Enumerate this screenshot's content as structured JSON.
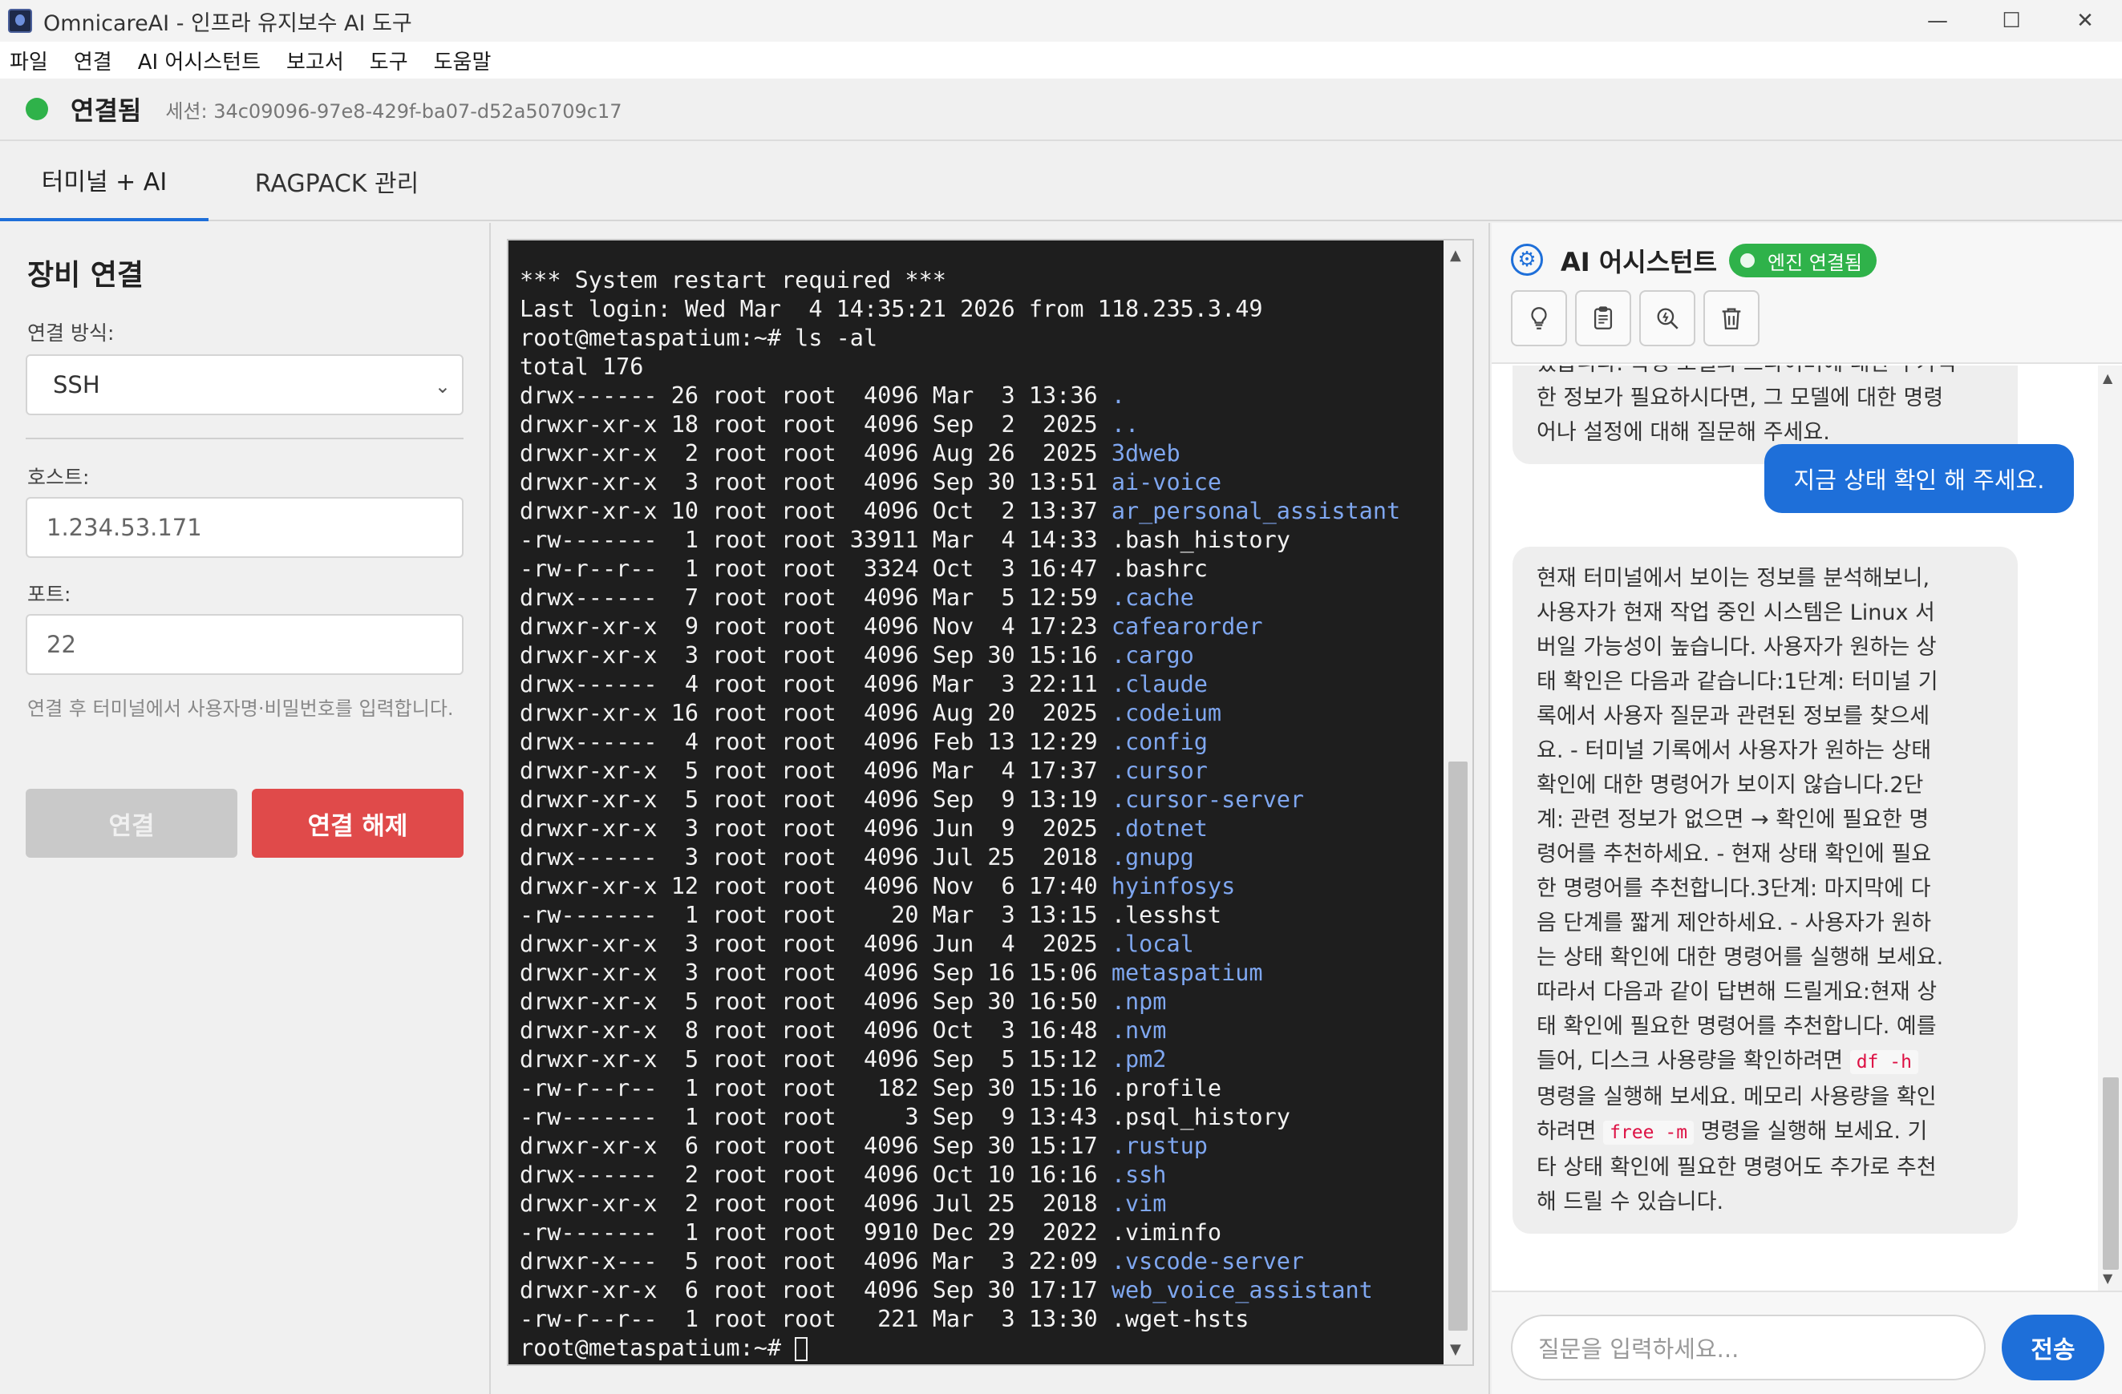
{
  "window": {
    "title": "OmnicareAI - 인프라 유지보수 AI 도구",
    "controls": {
      "minimize": "—",
      "maximize": "☐",
      "close": "✕"
    }
  },
  "menu": [
    "파일",
    "연결",
    "AI 어시스턴트",
    "보고서",
    "도구",
    "도움말"
  ],
  "status": {
    "state": "연결됨",
    "session": "세션: 34c09096-97e8-429f-ba07-d52a50709c17",
    "dot_color": "#2fb24a"
  },
  "tabs": [
    {
      "label": "터미널 + AI",
      "active": true
    },
    {
      "label": "RAGPACK 관리",
      "active": false
    }
  ],
  "device": {
    "title": "장비 연결",
    "method_label": "연결 방식:",
    "method_value": "SSH",
    "host_label": "호스트:",
    "host_value": "1.234.53.171",
    "port_label": "포트:",
    "port_value": "22",
    "hint": "연결 후 터미널에서 사용자명·비밀번호를 입력합니다.",
    "connect_button": "연결",
    "disconnect_button": "연결 해제"
  },
  "terminal": {
    "lines": [
      {
        "text": "*** System restart required ***",
        "name": ""
      },
      {
        "text": "Last login: Wed Mar  4 14:35:21 2026 from 118.235.3.49",
        "name": ""
      },
      {
        "text": "root@metaspatium:~# ls -al",
        "name": ""
      },
      {
        "text": "total 176",
        "name": ""
      },
      {
        "text": "drwx------ 26 root root  4096 Mar  3 13:36 ",
        "name": ".",
        "dir": true
      },
      {
        "text": "drwxr-xr-x 18 root root  4096 Sep  2  2025 ",
        "name": "..",
        "dir": true
      },
      {
        "text": "drwxr-xr-x  2 root root  4096 Aug 26  2025 ",
        "name": "3dweb",
        "dir": true
      },
      {
        "text": "drwxr-xr-x  3 root root  4096 Sep 30 13:51 ",
        "name": "ai-voice",
        "dir": true
      },
      {
        "text": "drwxr-xr-x 10 root root  4096 Oct  2 13:37 ",
        "name": "ar_personal_assistant",
        "dir": true
      },
      {
        "text": "-rw-------  1 root root 33911 Mar  4 14:33 ",
        "name": ".bash_history",
        "dir": false
      },
      {
        "text": "-rw-r--r--  1 root root  3324 Oct  3 16:47 ",
        "name": ".bashrc",
        "dir": false
      },
      {
        "text": "drwx------  7 root root  4096 Mar  5 12:59 ",
        "name": ".cache",
        "dir": true
      },
      {
        "text": "drwxr-xr-x  9 root root  4096 Nov  4 17:23 ",
        "name": "cafearorder",
        "dir": true
      },
      {
        "text": "drwxr-xr-x  3 root root  4096 Sep 30 15:16 ",
        "name": ".cargo",
        "dir": true
      },
      {
        "text": "drwx------  4 root root  4096 Mar  3 22:11 ",
        "name": ".claude",
        "dir": true
      },
      {
        "text": "drwxr-xr-x 16 root root  4096 Aug 20  2025 ",
        "name": ".codeium",
        "dir": true
      },
      {
        "text": "drwx------  4 root root  4096 Feb 13 12:29 ",
        "name": ".config",
        "dir": true
      },
      {
        "text": "drwxr-xr-x  5 root root  4096 Mar  4 17:37 ",
        "name": ".cursor",
        "dir": true
      },
      {
        "text": "drwxr-xr-x  5 root root  4096 Sep  9 13:19 ",
        "name": ".cursor-server",
        "dir": true
      },
      {
        "text": "drwxr-xr-x  3 root root  4096 Jun  9  2025 ",
        "name": ".dotnet",
        "dir": true
      },
      {
        "text": "drwx------  3 root root  4096 Jul 25  2018 ",
        "name": ".gnupg",
        "dir": true
      },
      {
        "text": "drwxr-xr-x 12 root root  4096 Nov  6 17:40 ",
        "name": "hyinfosys",
        "dir": true
      },
      {
        "text": "-rw-------  1 root root    20 Mar  3 13:15 ",
        "name": ".lesshst",
        "dir": false
      },
      {
        "text": "drwxr-xr-x  3 root root  4096 Jun  4  2025 ",
        "name": ".local",
        "dir": true
      },
      {
        "text": "drwxr-xr-x  3 root root  4096 Sep 16 15:06 ",
        "name": "metaspatium",
        "dir": true
      },
      {
        "text": "drwxr-xr-x  5 root root  4096 Sep 30 16:50 ",
        "name": ".npm",
        "dir": true
      },
      {
        "text": "drwxr-xr-x  8 root root  4096 Oct  3 16:48 ",
        "name": ".nvm",
        "dir": true
      },
      {
        "text": "drwxr-xr-x  5 root root  4096 Sep  5 15:12 ",
        "name": ".pm2",
        "dir": true
      },
      {
        "text": "-rw-r--r--  1 root root   182 Sep 30 15:16 ",
        "name": ".profile",
        "dir": false
      },
      {
        "text": "-rw-------  1 root root     3 Sep  9 13:43 ",
        "name": ".psql_history",
        "dir": false
      },
      {
        "text": "drwxr-xr-x  6 root root  4096 Sep 30 15:17 ",
        "name": ".rustup",
        "dir": true
      },
      {
        "text": "drwx------  2 root root  4096 Oct 10 16:16 ",
        "name": ".ssh",
        "dir": true
      },
      {
        "text": "drwxr-xr-x  2 root root  4096 Jul 25  2018 ",
        "name": ".vim",
        "dir": true
      },
      {
        "text": "-rw-------  1 root root  9910 Dec 29  2022 ",
        "name": ".viminfo",
        "dir": false
      },
      {
        "text": "drwxr-x---  5 root root  4096 Mar  3 22:09 ",
        "name": ".vscode-server",
        "dir": true
      },
      {
        "text": "drwxr-xr-x  6 root root  4096 Sep 30 17:17 ",
        "name": "web_voice_assistant",
        "dir": true
      },
      {
        "text": "-rw-r--r--  1 root root   221 Mar  3 13:30 ",
        "name": ".wget-hsts",
        "dir": false
      }
    ],
    "prompt": "root@metaspatium:~# ",
    "dir_color": "#7fa7f0"
  },
  "ai": {
    "title": "AI 어시스턴트",
    "engine_badge": "엔진 연결됨",
    "tools": [
      "lightbulb-icon",
      "clipboard-icon",
      "zoom-search-icon",
      "trash-icon"
    ],
    "messages": {
      "prev_ai_partial_line1": "었습니다. 특정 모델의 드라이버에 대한 추가적",
      "prev_ai_partial_line2": "한 정보가 필요하시다면, 그 모델에 대한 명령",
      "prev_ai_partial_line3": "어나 설정에 대해 질문해 주세요.",
      "user": "지금 상태 확인 해 주세요.",
      "ai_lines": [
        "현재 터미널에서 보이는 정보를 분석해보니,",
        "사용자가 현재 작업 중인 시스템은 Linux 서",
        "버일 가능성이 높습니다. 사용자가 원하는 상",
        "태 확인은 다음과 같습니다:1단계: 터미널 기",
        "록에서 사용자 질문과 관련된 정보를 찾으세",
        "요. - 터미널 기록에서 사용자가 원하는 상태",
        "확인에 대한 명령어가 보이지 않습니다.2단",
        "계: 관련 정보가 없으면 → 확인에 필요한 명",
        "령어를 추천하세요. - 현재 상태 확인에 필요",
        "한 명령어를 추천합니다.3단계: 마지막에 다",
        "음 단계를 짧게 제안하세요. - 사용자가 원하",
        "는 상태 확인에 대한 명령어를 실행해 보세요.",
        "따라서 다음과 같이 답변해 드릴게요:현재 상",
        "태 확인에 필요한 명령어를 추천합니다. 예를"
      ],
      "ai_line15_pre": "들어, 디스크 사용량을 확인하려면 ",
      "ai_code1": "df -h",
      "ai_line16": "명령을 실행해 보세요. 메모리 사용량을 확인",
      "ai_line17_pre": "하려면 ",
      "ai_code2": "free -m",
      "ai_line17_post": " 명령을 실행해 보세요. 기",
      "ai_line18": "타 상태 확인에 필요한 명령어도 추가로 추천",
      "ai_line19": "해 드릴 수 있습니다."
    },
    "input_placeholder": "질문을 입력하세요...",
    "send_button": "전송",
    "accent": "#1e6fd9"
  }
}
